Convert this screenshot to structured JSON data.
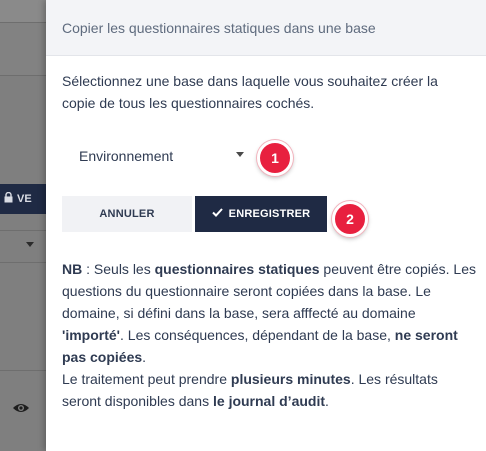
{
  "background": {
    "button_label": "VE",
    "icons": [
      "lock-icon",
      "caret-down-icon",
      "eye-icon"
    ]
  },
  "dialog": {
    "title": "Copier les questionnaires statiques dans une base",
    "intro": "Sélectionnez une base dans laquelle vous souhaitez créer la copie de tous les questionnaires cochés.",
    "select": {
      "value": "Environnement",
      "icon": "caret-down-icon"
    },
    "buttons": {
      "cancel": "ANNULER",
      "save": "ENREGISTRER",
      "save_icon": "check-icon"
    },
    "steps": [
      "1",
      "2"
    ],
    "note": {
      "nb": "NB",
      "t1": " : Seuls les ",
      "b1": "questionnaires statiques",
      "t2": " peuvent être copiés. Les questions du questionnaire seront copiées dans la base. Le domaine, si défini dans la base, sera afffecté au domaine ",
      "b2": "'importé'",
      "t3": ". Les conséquences, dépendant de la base, ",
      "b3": "ne seront pas copiées",
      "t4": ".",
      "t5": "Le traitement peut prendre ",
      "b4": "plusieurs minutes",
      "t6": ". Les résultats seront disponibles dans ",
      "b5": "le journal d’audit",
      "t7": "."
    }
  },
  "colors": {
    "primary": "#1f2a44",
    "badge": "#e8203f",
    "overlay": "#7f7f7f"
  }
}
